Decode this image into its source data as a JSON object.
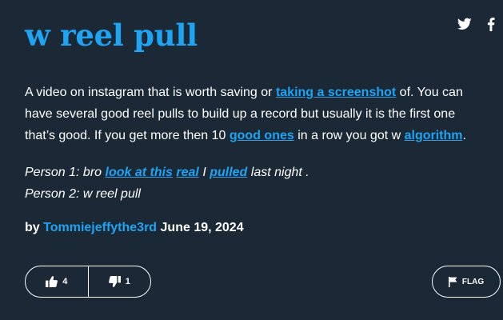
{
  "definition": {
    "word": "w reel pull",
    "meaning": {
      "t1": "A video on instagram that is worth saving or ",
      "l1": "taking a screenshot",
      "t2": " of. You can have several good reel pulls to build up a record but usually it is the first one that’s good. If you get more then 10 ",
      "l2": "good ones",
      "t3": " in a row you got w ",
      "l3": "algorithm",
      "t4": "."
    },
    "example": {
      "line1_a": "Person 1: bro ",
      "line1_l1": "look at this",
      "line1_b": " ",
      "line1_l2": "real",
      "line1_c": " I ",
      "line1_l3": "pulled",
      "line1_d": " last night .",
      "line2": "Person 2: w reel pull"
    },
    "byline": {
      "prefix": "by ",
      "author": "Tommiejeffythe3rd",
      "date": " June 19, 2024"
    }
  },
  "votes": {
    "up": "4",
    "down": "1"
  },
  "flag_label": "FLAG",
  "icons": {
    "share_twitter": "twitter-icon",
    "share_facebook": "facebook-icon",
    "thumbs_up": "thumbs-up-icon",
    "thumbs_down": "thumbs-down-icon",
    "flag": "flag-icon"
  },
  "colors": {
    "background": "#1b2936",
    "accent": "#1fa3f3",
    "text": "#ffffff"
  }
}
